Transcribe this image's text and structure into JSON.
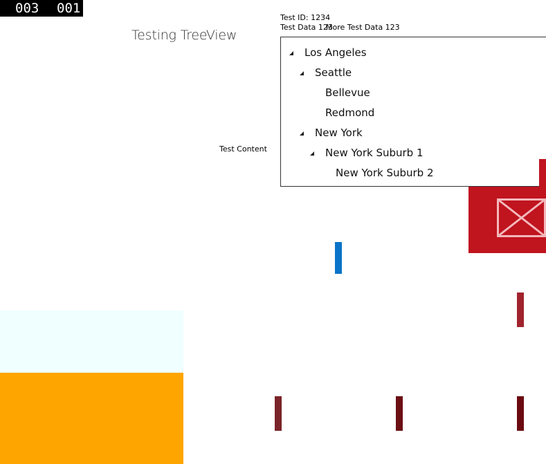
{
  "counters": {
    "left": "003",
    "right": "001"
  },
  "page_title": "Testing TreeView",
  "test_id_label": "Test ID: 1234",
  "test_data_label_1": "Test Data 123",
  "test_data_label_2": "More Test Data 123",
  "test_content_label": "Test Content",
  "tree": {
    "items": [
      {
        "label": "Los Angeles",
        "level": 0,
        "expanded": true
      },
      {
        "label": "Seattle",
        "level": 1,
        "expanded": true
      },
      {
        "label": "Bellevue",
        "level": 2,
        "expanded": false
      },
      {
        "label": "Redmond",
        "level": 2,
        "expanded": false
      },
      {
        "label": "New York",
        "level": 1,
        "expanded": true
      },
      {
        "label": "New York Suburb 1",
        "level": 2,
        "expanded": true
      },
      {
        "label": "New York Suburb 2",
        "level": 3,
        "expanded": false
      }
    ]
  },
  "colors": {
    "red_tile": "#c0141f",
    "blue_bar": "#0a74c9",
    "azure_block": "#f0ffff",
    "orange_block": "#ffa500"
  },
  "icons": {
    "red_tile_icon": "close-icon",
    "tree_expander": "chevron-expanded-icon"
  }
}
